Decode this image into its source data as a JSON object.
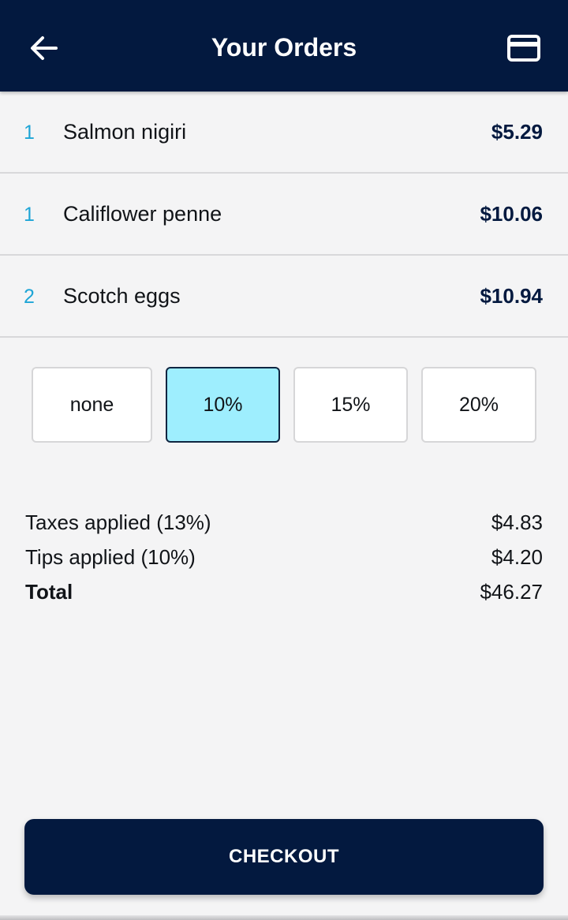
{
  "header": {
    "title": "Your Orders",
    "back_icon": "arrow-left-icon",
    "card_icon": "credit-card-icon",
    "color": "#03193f"
  },
  "orders": [
    {
      "qty": "1",
      "name": "Salmon nigiri",
      "price": "$5.29"
    },
    {
      "qty": "1",
      "name": "Califlower penne",
      "price": "$10.06"
    },
    {
      "qty": "2",
      "name": "Scotch eggs",
      "price": "$10.94"
    }
  ],
  "tips": {
    "options": [
      "none",
      "10%",
      "15%",
      "20%"
    ],
    "selected": "10%",
    "selected_color": "#9eeefe"
  },
  "summary": {
    "taxes_label": "Taxes applied (13%)",
    "taxes_value": "$4.83",
    "tips_label": "Tips applied (10%)",
    "tips_value": "$4.20",
    "total_label": "Total",
    "total_value": "$46.27"
  },
  "checkout": {
    "label": "CHECKOUT"
  }
}
